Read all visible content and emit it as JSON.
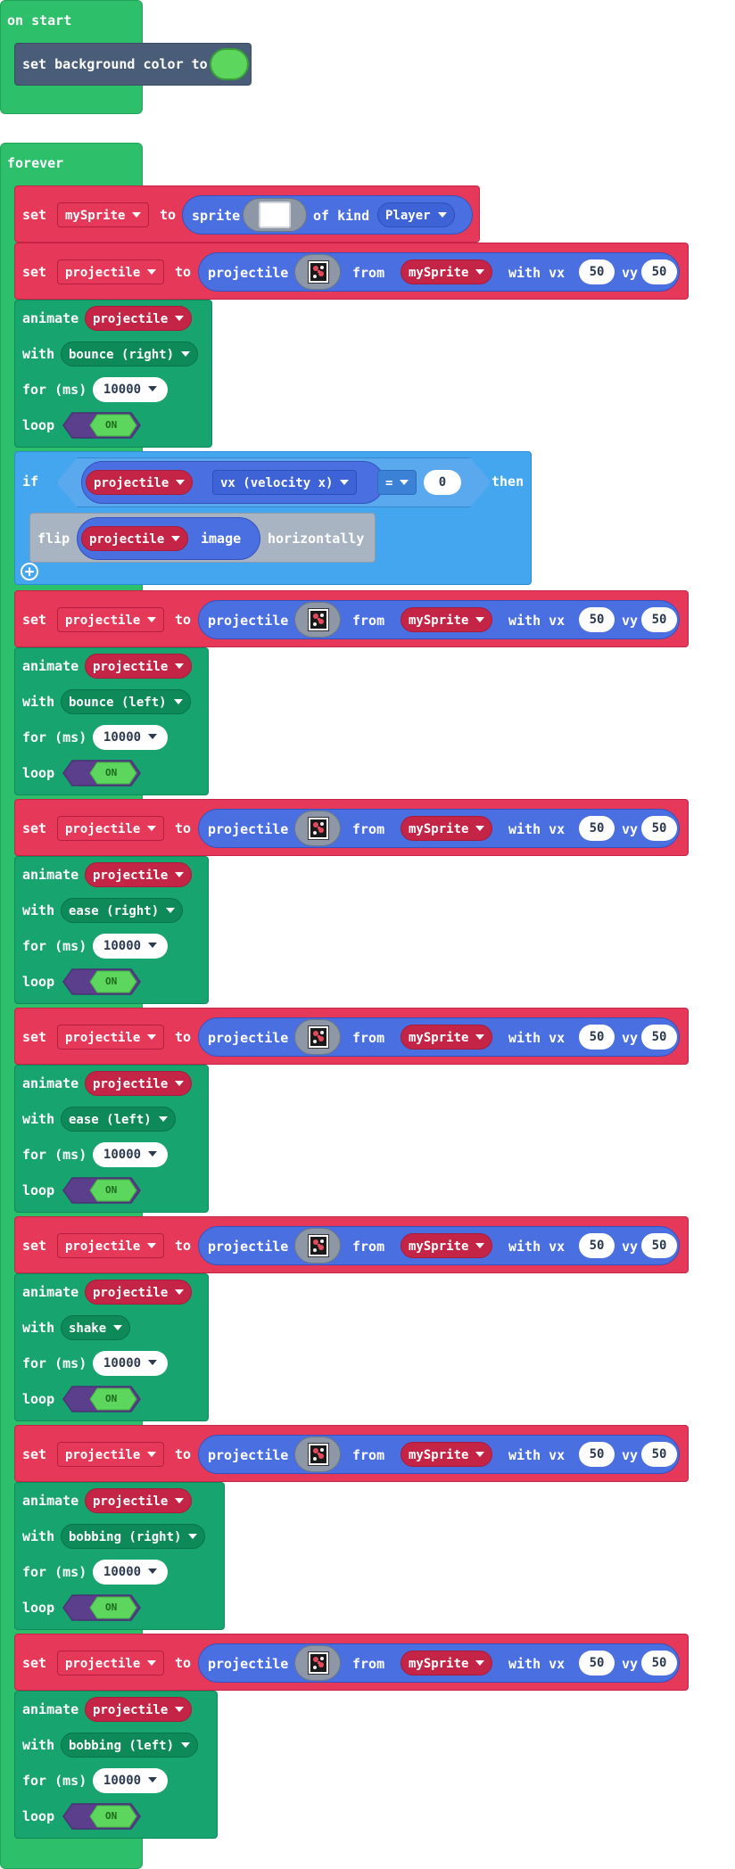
{
  "on_start": {
    "label": "on start",
    "set_background_label": "set background color to",
    "background_color": "#5cd65c"
  },
  "forever": {
    "label": "forever",
    "set_my_sprite": {
      "set_label": "set",
      "var_name": "mySprite",
      "to_label": "to",
      "sprite_label": "sprite",
      "of_kind_label": "of kind",
      "kind_value": "Player"
    },
    "if_block": {
      "if_label": "if",
      "var_name": "projectile",
      "property": "vx (velocity x)",
      "operator": "=",
      "compare_value": "0",
      "then_label": "then",
      "flip_label": "flip",
      "flip_var": "projectile",
      "image_label": "image",
      "horizontally_label": "horizontally"
    },
    "common": {
      "set_label": "set",
      "var_name": "projectile",
      "to_label": "to",
      "projectile_label": "projectile",
      "from_label": "from",
      "from_sprite": "mySprite",
      "with_vx_label": "with vx",
      "vx": "50",
      "vy_label": "vy",
      "vy": "50",
      "animate_label": "animate",
      "with_label": "with",
      "for_ms_label": "for (ms)",
      "loop_label": "loop",
      "on_label": "ON"
    },
    "groups": [
      {
        "anim": "bounce (right)",
        "duration": "10000"
      },
      {
        "anim": "bounce (left)",
        "duration": "10000"
      },
      {
        "anim": "ease (right)",
        "duration": "10000"
      },
      {
        "anim": "ease (left)",
        "duration": "10000"
      },
      {
        "anim": "shake",
        "duration": "10000"
      },
      {
        "anim": "bobbing (right)",
        "duration": "10000"
      },
      {
        "anim": "bobbing (left)",
        "duration": "10000"
      }
    ]
  }
}
